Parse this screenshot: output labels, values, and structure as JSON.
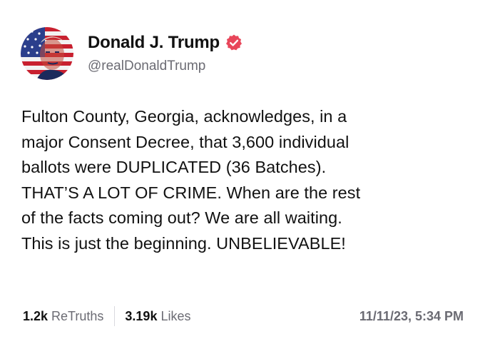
{
  "author": {
    "name": "Donald J. Trump",
    "handle": "@realDonaldTrump",
    "verified_color": "#e8465a"
  },
  "post": {
    "lines": [
      "Fulton County, Georgia, acknowledges, in a",
      "major Consent Decree, that 3,600 individual",
      "ballots were DUPLICATED (36 Batches).",
      "THAT’S A LOT OF CRIME. When are the rest",
      "of the facts coming out? We are all waiting.",
      "This is just the beginning. UNBELIEVABLE!"
    ]
  },
  "stats": {
    "retruths_count": "1.2k",
    "retruths_label": "ReTruths",
    "likes_count": "3.19k",
    "likes_label": "Likes"
  },
  "timestamp": "11/11/23, 5:34 PM",
  "icons": {
    "avatar": "avatar-flag-portrait",
    "verified": "verified-badge-icon"
  }
}
